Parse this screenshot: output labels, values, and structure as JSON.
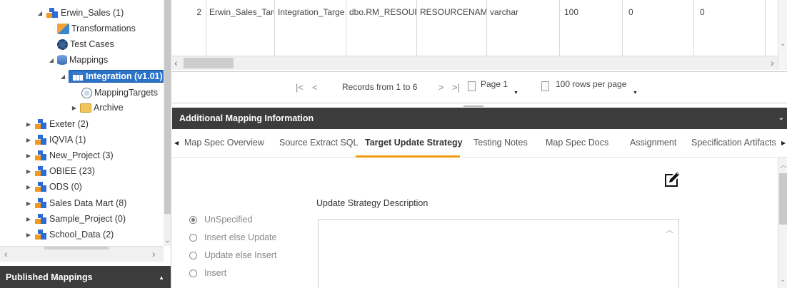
{
  "tree": {
    "nodes": [
      {
        "label": "Erwin_Sales (1)",
        "icon": "project-icon"
      },
      {
        "label": "Transformations",
        "icon": "transformations-icon"
      },
      {
        "label": "Test Cases",
        "icon": "test-cases-icon"
      },
      {
        "label": "Mappings",
        "icon": "database-icon"
      },
      {
        "label": "Integration (v1.01)",
        "icon": "table-icon"
      },
      {
        "label": "MappingTargets",
        "icon": "globe-icon"
      },
      {
        "label": "Archive",
        "icon": "folder-icon"
      },
      {
        "label": "Exeter (2)",
        "icon": "project-icon"
      },
      {
        "label": "IQVIA (1)",
        "icon": "project-icon"
      },
      {
        "label": "New_Project (3)",
        "icon": "project-icon"
      },
      {
        "label": "OBIEE (23)",
        "icon": "project-icon"
      },
      {
        "label": "ODS (0)",
        "icon": "project-icon"
      },
      {
        "label": "Sales Data Mart (8)",
        "icon": "project-icon"
      },
      {
        "label": "Sample_Project (0)",
        "icon": "project-icon"
      },
      {
        "label": "School_Data (2)",
        "icon": "project-icon"
      }
    ]
  },
  "published_mappings": {
    "label": "Published Mappings"
  },
  "grid": {
    "row": [
      "2",
      "Erwin_Sales_Targe",
      "Integration_Targe",
      "dbo.RM_RESOURC",
      "RESOURCENAME_",
      "varchar",
      "100",
      "0",
      "0"
    ]
  },
  "pager": {
    "first": "|<",
    "prev": "<",
    "records": "Records from 1 to 6",
    "next": ">",
    "last": ">|",
    "page": "Page 1",
    "rows_per_page": "100 rows per page"
  },
  "additional_mapping": {
    "title": "Additional Mapping Information"
  },
  "tabs": [
    {
      "label": "Map Spec Overview",
      "active": false
    },
    {
      "label": "Source Extract SQL",
      "active": false
    },
    {
      "label": "Target Update Strategy",
      "active": true
    },
    {
      "label": "Testing Notes",
      "active": false
    },
    {
      "label": "Map Spec Docs",
      "active": false
    },
    {
      "label": "Assignment",
      "active": false
    },
    {
      "label": "Specification Artifacts",
      "active": false
    }
  ],
  "strategy": {
    "description_label": "Update Strategy Description",
    "description_value": "",
    "options": [
      {
        "label": "UnSpecified",
        "selected": true
      },
      {
        "label": "Insert else Update",
        "selected": false
      },
      {
        "label": "Update else Insert",
        "selected": false
      },
      {
        "label": "Insert",
        "selected": false
      }
    ]
  },
  "colors": {
    "accent": "#f39c12",
    "selected_node": "#2a72c8",
    "header_bar": "#3c3c3c"
  }
}
